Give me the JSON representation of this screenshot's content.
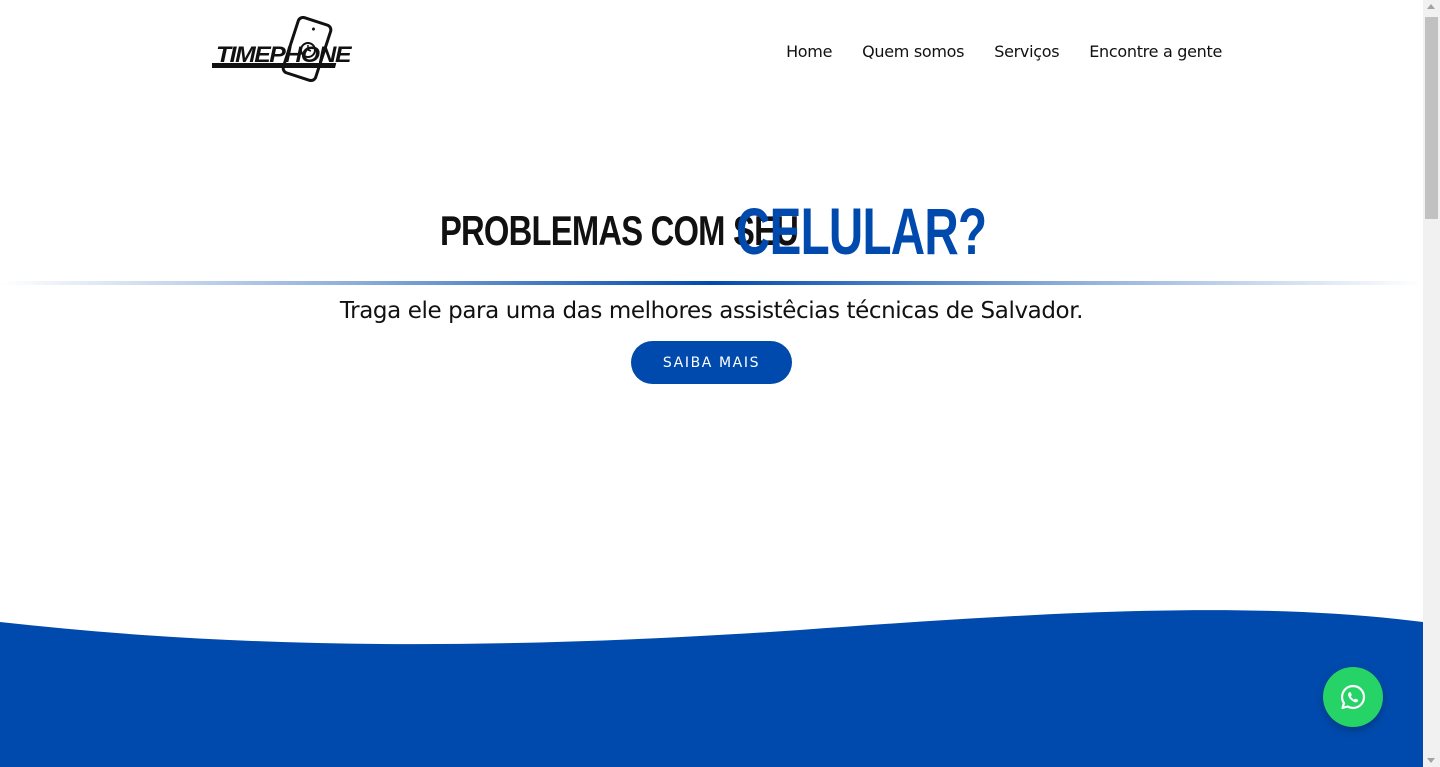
{
  "header": {
    "logo_text": "TIMEPHONE",
    "nav": [
      {
        "label": "Home"
      },
      {
        "label": "Quem somos"
      },
      {
        "label": "Serviços"
      },
      {
        "label": "Encontre a gente"
      }
    ]
  },
  "hero": {
    "headline_dark": "PROBLEMAS COM SEU",
    "headline_blue": "CELULAR?",
    "subtitle": "Traga ele para uma das melhores assistêcias técnicas de Salvador.",
    "cta_label": "SAIBA MAIS"
  },
  "colors": {
    "brand_blue": "#004aad",
    "whatsapp_green": "#25d366",
    "text": "#111111",
    "background": "#ffffff"
  },
  "icons": {
    "whatsapp": "whatsapp-icon",
    "logo": "phone-alarm-logo"
  }
}
